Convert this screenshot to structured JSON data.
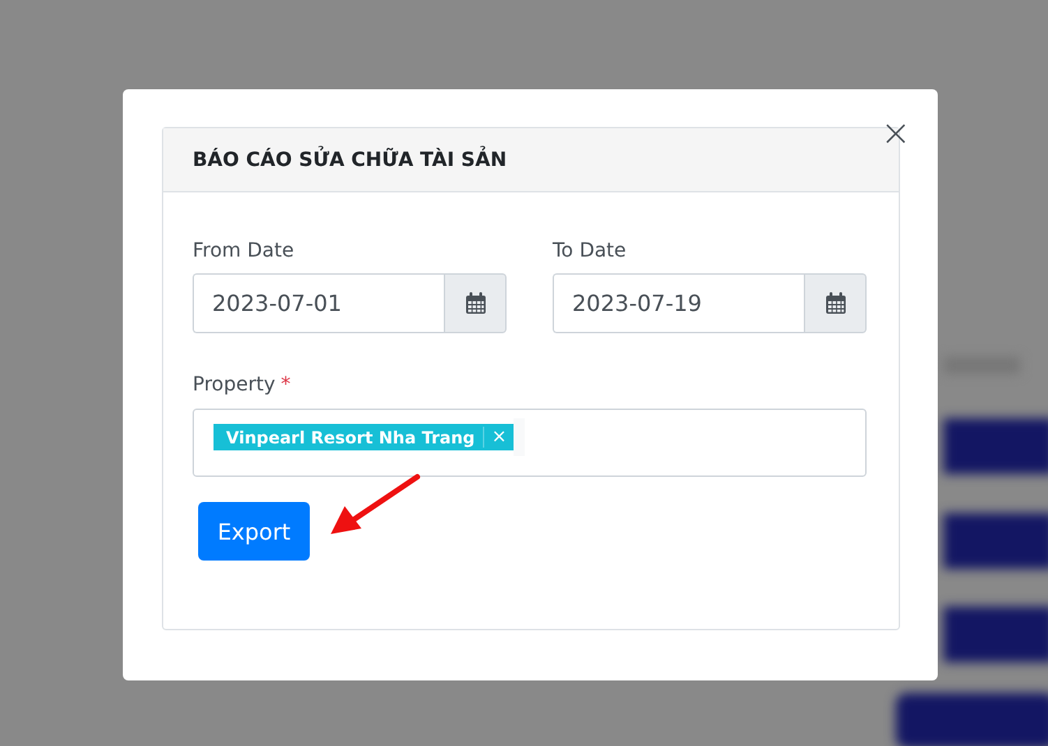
{
  "dialog": {
    "title": "BÁO CÁO SỬA CHỮA TÀI SẢN",
    "close_symbol": "×"
  },
  "fields": [
    {
      "label": "From Date",
      "value": "2023-07-01"
    },
    {
      "label": "To Date",
      "value": "2023-07-19"
    }
  ],
  "property": {
    "label": "Property",
    "required": true,
    "required_mark": "*",
    "tags": [
      {
        "label": "Vinpearl Resort Nha Trang",
        "remove_symbol": "×"
      }
    ]
  },
  "export_button": "Export"
}
